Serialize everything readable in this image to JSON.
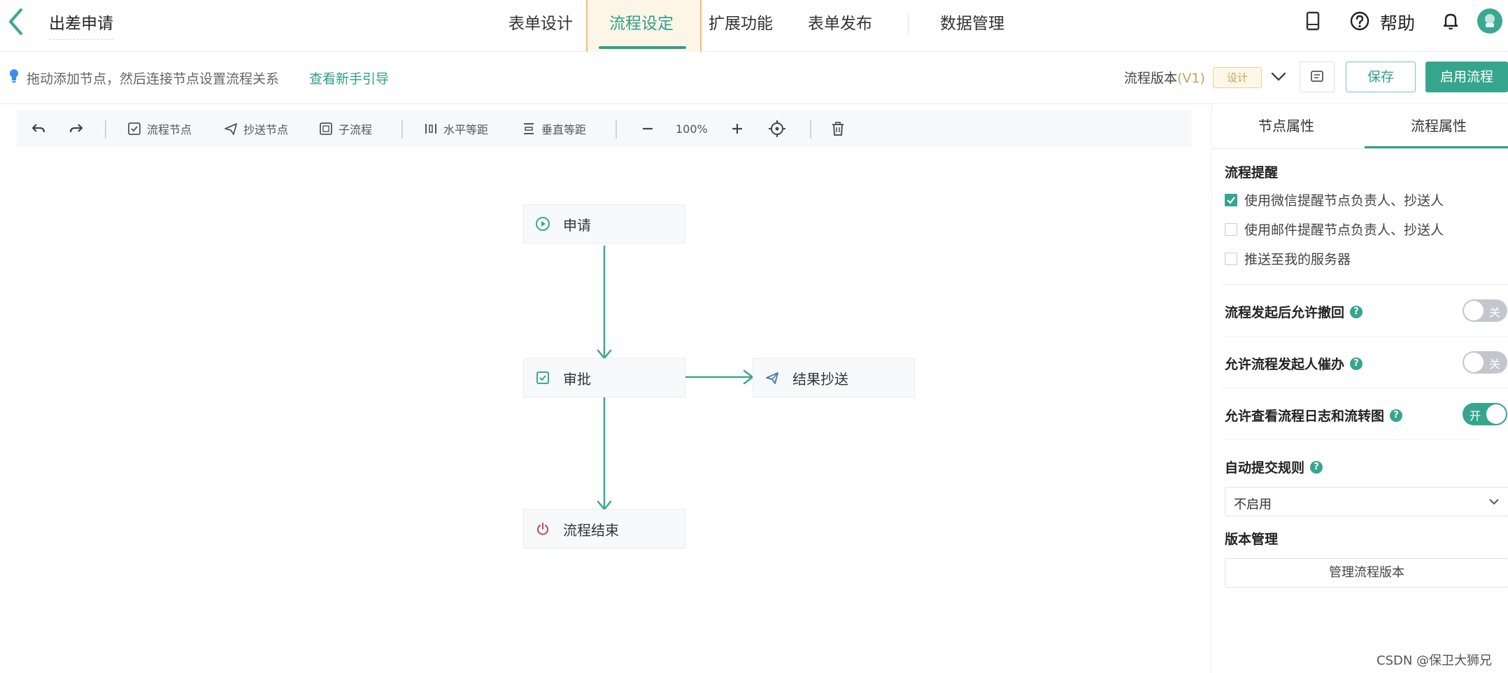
{
  "app": {
    "title": "出差申请"
  },
  "nav": {
    "tabs": [
      {
        "label": "表单设计"
      },
      {
        "label": "流程设定"
      },
      {
        "label": "扩展功能"
      },
      {
        "label": "表单发布"
      },
      {
        "label": "数据管理"
      }
    ],
    "active_index": 1
  },
  "header": {
    "help_label": "帮助"
  },
  "hint": {
    "text": "拖动添加节点，然后连接节点设置流程关系",
    "link": "查看新手引导"
  },
  "version": {
    "label": "流程版本",
    "number": "(V1)",
    "badge": "设计"
  },
  "actions": {
    "save": "保存",
    "enable": "启用流程"
  },
  "toolbar": {
    "flow_node": "流程节点",
    "cc_node": "抄送节点",
    "subflow": "子流程",
    "h_spacing": "水平等距",
    "v_spacing": "垂直等距",
    "zoom": "100%"
  },
  "flow": {
    "nodes": [
      {
        "label": "申请"
      },
      {
        "label": "审批"
      },
      {
        "label": "结果抄送"
      },
      {
        "label": "流程结束"
      }
    ]
  },
  "panel": {
    "tabs": [
      {
        "label": "节点属性"
      },
      {
        "label": "流程属性"
      }
    ],
    "active_tab": 1,
    "reminder": {
      "title": "流程提醒",
      "options": [
        {
          "label": "使用微信提醒节点负责人、抄送人",
          "checked": true
        },
        {
          "label": "使用邮件提醒节点负责人、抄送人",
          "checked": false
        },
        {
          "label": "推送至我的服务器",
          "checked": false
        }
      ]
    },
    "toggles": [
      {
        "label": "流程发起后允许撤回",
        "state": "关",
        "on": false
      },
      {
        "label": "允许流程发起人催办",
        "state": "关",
        "on": false
      },
      {
        "label": "允许查看流程日志和流转图",
        "state": "开",
        "on": true
      }
    ],
    "auto_submit": {
      "title": "自动提交规则",
      "value": "不启用"
    },
    "version_mgmt": {
      "title": "版本管理",
      "button": "管理流程版本"
    }
  },
  "colors": {
    "accent": "#35a58e",
    "active_tab_frame": "#e8c27b"
  },
  "watermark": "CSDN @保卫大狮兄"
}
